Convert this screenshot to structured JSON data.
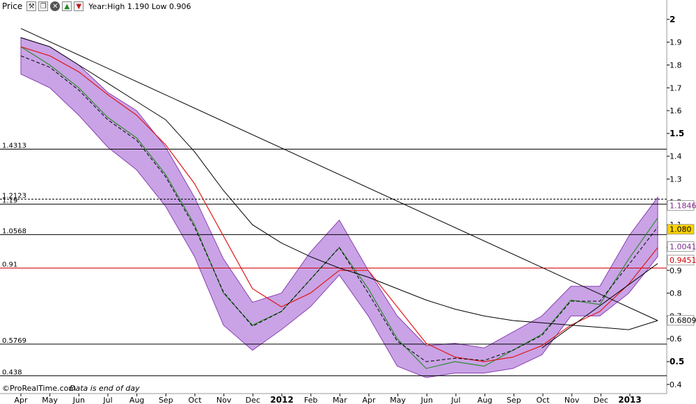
{
  "toolbar": {
    "price_label": "Price",
    "info": "Year:High 1.190 Low 0.906",
    "icons": [
      "wrench-icon",
      "window-icon",
      "close-icon",
      "arrow-up-icon",
      "arrow-down-icon"
    ]
  },
  "footer": {
    "brand": "©ProRealTime.com",
    "note": "Data is end of day"
  },
  "chart_data": {
    "type": "line",
    "ylim": [
      0.36,
      2.03
    ],
    "y_ticks": [
      "0.4",
      "0.5",
      "0.6",
      "0.7",
      "0.8",
      "0.9",
      "1",
      "1.1",
      "1.2",
      "1.3",
      "1.4",
      "1.5",
      "1.6",
      "1.7",
      "1.8",
      "1.9",
      "2"
    ],
    "y_ticks_bold": [
      "0.5",
      "1",
      "1.5",
      "2"
    ],
    "x_ticks": [
      "Apr",
      "May",
      "Jun",
      "Jul",
      "Aug",
      "Sep",
      "Oct",
      "Nov",
      "Dec",
      "2012",
      "Feb",
      "Mar",
      "Apr",
      "May",
      "Jun",
      "Jul",
      "Aug",
      "Sep",
      "Oct",
      "Nov",
      "Dec",
      "2013"
    ],
    "x_ticks_bold": [
      "2012",
      "2013"
    ],
    "x": [
      "Apr",
      "May",
      "Jun",
      "Jul",
      "Aug",
      "Sep",
      "Oct",
      "Nov",
      "Dec",
      "2012",
      "Feb",
      "Mar",
      "Apr",
      "May",
      "Jun",
      "Jul",
      "Aug",
      "Sep",
      "Oct",
      "Nov",
      "Dec",
      "2013",
      "Feb"
    ],
    "series": [
      {
        "values": [
          1.88,
          1.8,
          1.7,
          1.57,
          1.48,
          1.32,
          1.1,
          0.8,
          0.66,
          0.72,
          0.86,
          1.0,
          0.82,
          0.6,
          0.47,
          0.5,
          0.48,
          0.55,
          0.62,
          0.77,
          0.75,
          0.95,
          1.13
        ]
      },
      {
        "values": [
          1.88,
          1.84,
          1.77,
          1.67,
          1.58,
          1.45,
          1.28,
          1.05,
          0.82,
          0.74,
          0.8,
          0.9,
          0.9,
          0.74,
          0.58,
          0.52,
          0.5,
          0.52,
          0.57,
          0.66,
          0.72,
          0.84,
          1.0
        ]
      },
      {
        "values": [
          1.92,
          1.88,
          1.8,
          1.72,
          1.64,
          1.56,
          1.42,
          1.25,
          1.1,
          1.02,
          0.96,
          0.91,
          0.87,
          0.82,
          0.77,
          0.73,
          0.7,
          0.68,
          0.67,
          0.66,
          0.65,
          0.64,
          0.68
        ]
      }
    ],
    "band": {
      "upper": [
        1.92,
        1.88,
        1.8,
        1.68,
        1.6,
        1.44,
        1.22,
        0.95,
        0.76,
        0.8,
        0.98,
        1.12,
        0.9,
        0.7,
        0.57,
        0.58,
        0.56,
        0.63,
        0.7,
        0.83,
        0.83,
        1.05,
        1.22
      ],
      "lower": [
        1.76,
        1.7,
        1.58,
        1.44,
        1.34,
        1.18,
        0.96,
        0.66,
        0.55,
        0.64,
        0.74,
        0.88,
        0.7,
        0.48,
        0.43,
        0.45,
        0.45,
        0.47,
        0.53,
        0.7,
        0.7,
        0.8,
        0.96
      ]
    },
    "trendlines": [
      {
        "from": [
          "Apr",
          1.96
        ],
        "to": [
          "Feb",
          0.68
        ]
      },
      {
        "from": [
          "Oct",
          0.56
        ],
        "to": [
          "Feb",
          0.93
        ]
      }
    ],
    "hlines": [
      {
        "label": "1.4313",
        "y": 1.4313,
        "color": "#000000",
        "dashed": false
      },
      {
        "label": "1.2123",
        "y": 1.2123,
        "color": "#000000",
        "dashed": true
      },
      {
        "label": "1.19",
        "y": 1.19,
        "color": "#000000",
        "dashed": false
      },
      {
        "label": "1.0568",
        "y": 1.0568,
        "color": "#000000",
        "dashed": false
      },
      {
        "label": "0.91",
        "y": 0.91,
        "color": "#d40000",
        "dashed": false
      },
      {
        "label": "0.5769",
        "y": 0.5769,
        "color": "#000000",
        "dashed": false
      },
      {
        "label": "0.438",
        "y": 0.438,
        "color": "#000000",
        "dashed": false
      }
    ],
    "right_labels": [
      {
        "text": "1.1846",
        "y": 1.1846,
        "fg": "#7a2a8a",
        "bg": "#ffffff",
        "border": "#888888"
      },
      {
        "text": "1.080",
        "y": 1.08,
        "fg": "#000000",
        "bg": "#ffd400",
        "border": "#888888"
      },
      {
        "text": "1.0041",
        "y": 1.0041,
        "fg": "#7a2a8a",
        "bg": "#ffffff",
        "border": "#888888"
      },
      {
        "text": "0.9451",
        "y": 0.9451,
        "fg": "#d40000",
        "bg": "#ffffff",
        "border": "#888888"
      },
      {
        "text": "0.6809",
        "y": 0.6809,
        "fg": "#000000",
        "bg": "#ffffff",
        "border": "#888888"
      }
    ],
    "colors": {
      "band_fill": "#c9a3e6",
      "band_edge": "#8a3fb0",
      "price": "#2e8b2e",
      "ma_fast": "#e01818",
      "ma_mid": "#000000",
      "ma_slow": "#000000"
    }
  }
}
